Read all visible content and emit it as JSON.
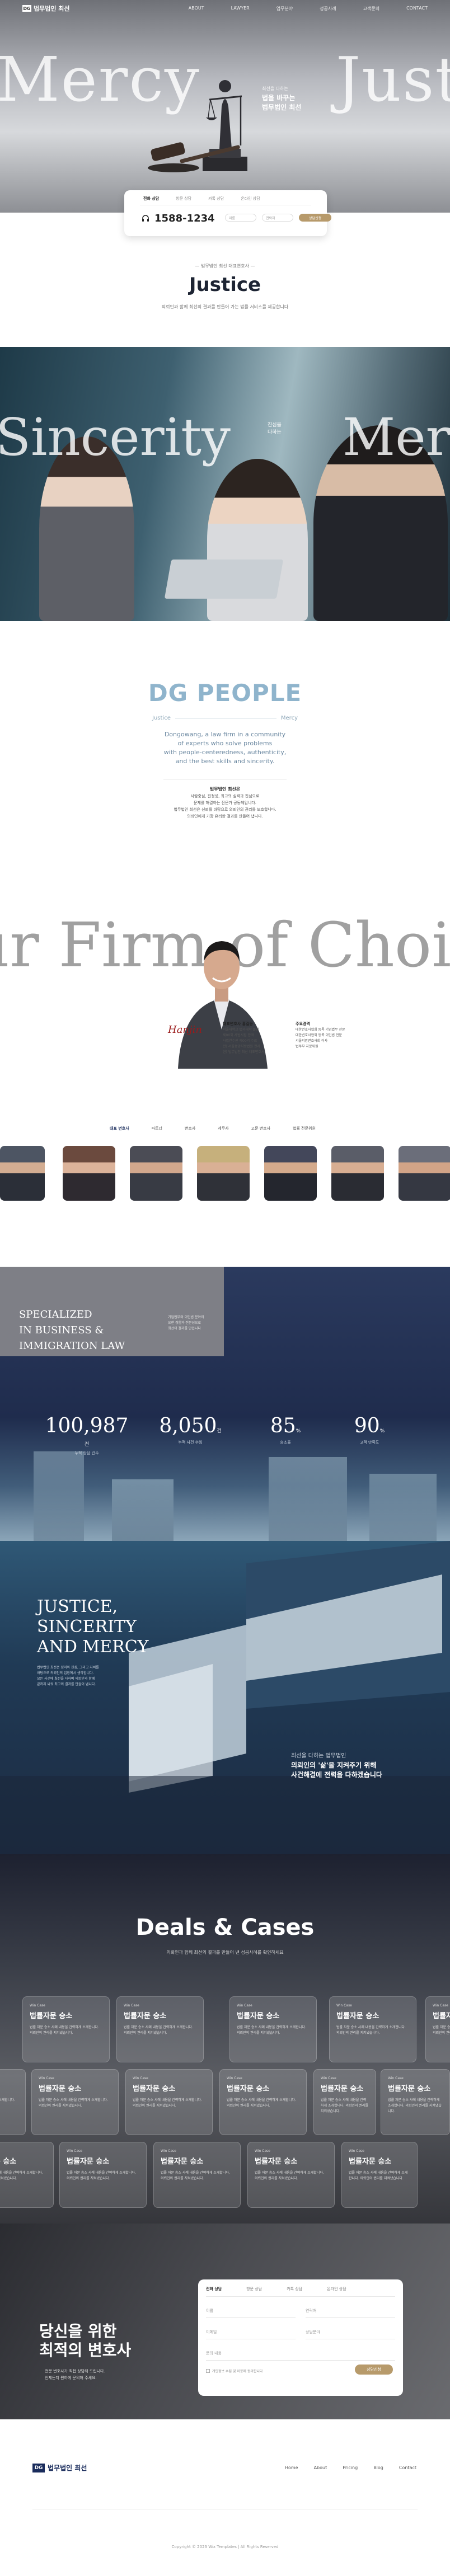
{
  "header": {
    "logo_mark": "DG",
    "logo_text": "법무법인 최선",
    "menu": [
      "ABOUT",
      "LAWYER",
      "업무분야",
      "성공사례",
      "고객문의",
      "CONTACT"
    ]
  },
  "hero": {
    "word_left": "Mercy",
    "word_right": "Justi",
    "copy_small": "최선을 다하는",
    "copy_line1": "법을 바꾸는",
    "copy_line2": "법무법인 최선"
  },
  "contact_box": {
    "tabs": [
      "전화 상담",
      "방문 상담",
      "카톡 상담",
      "온라인 상담"
    ],
    "phone": "1588-1234",
    "field_name": "이름",
    "field_phone": "연락처",
    "button": "상담신청"
  },
  "justice": {
    "kicker": "— 법무법인 최선 대표변호사 —",
    "title": "Justice",
    "subtitle": "의뢰인과 함께 최선의 결과를 만들어 가는 법률 서비스를 제공합니다"
  },
  "sincerity": {
    "word_left": "Sincerity",
    "word_right": "Mer",
    "mid_line1": "진심을",
    "mid_line2": "다하는"
  },
  "people": {
    "title": "DG PEOPLE",
    "left": "Justice",
    "right": "Mercy",
    "desc": [
      "Dongowang, a law firm in a community",
      "of experts who solve problems",
      "with people-centeredness, authenticity,",
      "and the best skills and sincerity."
    ],
    "info_title": "법무법인 최선은",
    "info": [
      "사람중심, 진정성, 최고의 실력과 진심으로",
      "문제를 해결하는 전문가 공동체입니다.",
      "법무법인 최선은 신뢰를 바탕으로 의뢰인의 권리를 보호합니다.",
      "의뢰인에게 가장 유리한 결과를 만들어 냅니다."
    ],
    "choice_text": "our Firm of Choice",
    "signature": "Hanjin",
    "cv_left_title": "대표변호사 홍길동",
    "cv_left": [
      "서울대학교 법과대학 졸업",
      "제00회 사법시험 합격",
      "사법연수원 제00기 수료",
      "전) 서울중앙지방법원 판사",
      "현) 법무법인 최선 대표변호사"
    ],
    "cv_right_title": "주요경력",
    "cv_right": [
      "대한변호사협회 등록 기업법무 전문",
      "대한변호사협회 등록 이민법 전문",
      "서울지방변호사회 이사",
      "법무부 자문위원"
    ],
    "tabs": [
      "대표 변호사",
      "파트너",
      "변호사",
      "세무사",
      "고문 변호사",
      "법률 전문위원"
    ]
  },
  "specialized": {
    "title_lines": [
      "SPECIALIZED",
      "IN BUSINESS &",
      "IMMIGRATION LAW"
    ],
    "sub": [
      "기업법무와 이민법 분야의",
      "오랜 경험과 전문성으로",
      "최선의 결과를 만듭니다"
    ],
    "stats": [
      {
        "value": "100,987",
        "unit": "건",
        "label": "누적 상담 건수"
      },
      {
        "value": "8,050",
        "unit": "건",
        "label": "누적 사건 수임"
      },
      {
        "value": "85",
        "unit": "%",
        "label": "승소율"
      },
      {
        "value": "90",
        "unit": "%",
        "label": "고객 만족도"
      }
    ]
  },
  "mercy": {
    "title_lines": [
      "JUSTICE,",
      "SINCERITY",
      "AND MERCY"
    ],
    "desc": [
      "법무법인 최선은 정의와 진심, 그리고 자비를",
      "바탕으로 의뢰인의 입장에서 생각합니다.",
      "모든 사건에 최선을 다하며 의뢰인과 함께",
      "끝까지 싸워 최고의 결과를 만들어 냅니다."
    ],
    "copy_small": "최선을 다하는 법무법인",
    "copy_line1": "의뢰인의 '삶'을 지켜주기 위해",
    "copy_line2": "사건해결에 전력을 다하겠습니다"
  },
  "deals": {
    "title": "Deals & Cases",
    "subtitle": "의뢰인과 함께 최선의 결과를 만들어 낸 성공사례를 확인하세요",
    "card_tag": "Win Case",
    "card_title": "법률자문 승소",
    "card_desc": "법률 자문 승소 사례 내용을 간략하게 소개합니다. 의뢰인의 권리를 지켜냈습니다."
  },
  "consult": {
    "title_line1": "당신을 위한",
    "title_line2": "최적의 변호사",
    "desc": [
      "전문 변호사가 직접 상담해 드립니다.",
      "언제든지 편하게 문의해 주세요."
    ],
    "tabs": [
      "전화 상담",
      "방문 상담",
      "카톡 상담",
      "온라인 상담"
    ],
    "fields": [
      "이름",
      "연락처",
      "이메일",
      "상담분야"
    ],
    "message": "문의 내용",
    "agree": "개인정보 수집 및 이용에 동의합니다",
    "button": "상담신청"
  },
  "footer": {
    "logo_mark": "DG",
    "logo_text": "법무법인 최선",
    "nav": [
      "Home",
      "About",
      "Pricing",
      "Blog",
      "Contact"
    ],
    "copyright": "Copyright © 2023 Wix Templates | All Rights Reserved"
  }
}
